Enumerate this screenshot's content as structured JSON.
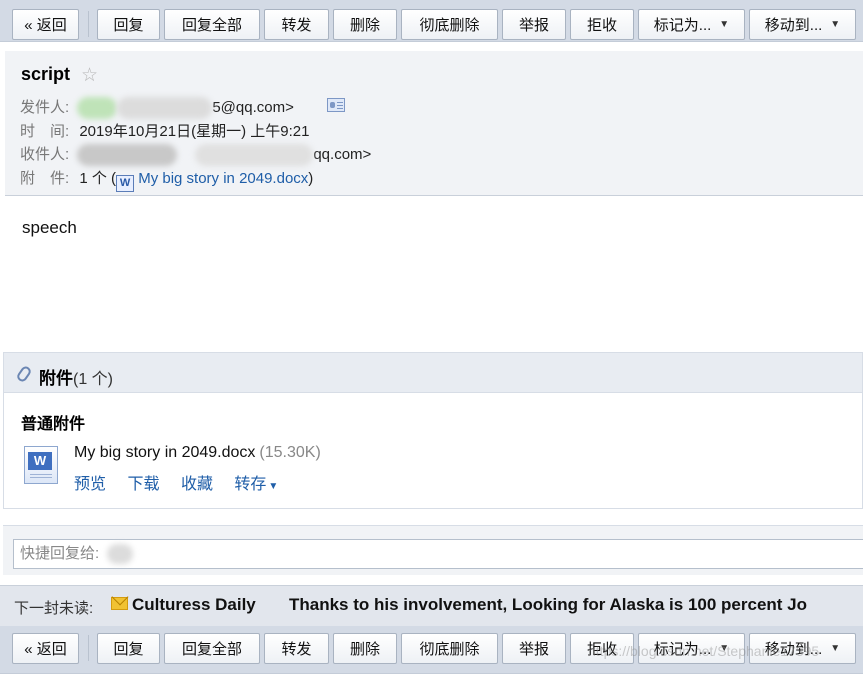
{
  "toolbar": {
    "back": "« 返回",
    "reply": "回复",
    "reply_all": "回复全部",
    "forward": "转发",
    "delete": "删除",
    "delete_perm": "彻底删除",
    "report": "举报",
    "reject": "拒收",
    "mark_as": "标记为...",
    "move_to": "移动到..."
  },
  "email": {
    "subject": "script",
    "from_label": "发件人:",
    "from_value": "5@qq.com>",
    "time_label": "时　间:",
    "time_value": "2019年10月21日(星期一) 上午9:21",
    "to_label": "收件人:",
    "to_value": "qq.com>",
    "attach_label": "附　件:",
    "attach_count": "1 个 (",
    "attach_file": "My big story in 2049.docx",
    "attach_close": ")",
    "body": "speech"
  },
  "attachments": {
    "title": "附件",
    "count": "(1 个)",
    "section_label": "普通附件",
    "file_name": "My big story in 2049.docx",
    "file_size": "(15.30K)",
    "preview": "预览",
    "download": "下载",
    "favorite": "收藏",
    "save_to": "转存"
  },
  "quick_reply": {
    "placeholder": "快捷回复给:"
  },
  "next_unread": {
    "label": "下一封未读:",
    "sender": "Culturess Daily",
    "subject": "Thanks to his involvement, Looking for Alaska is 100 percent Jo"
  },
  "watermark": "https://blog.csdn.net/Stephanie17395",
  "icons": {
    "star": "star-icon",
    "contact": "contact-card-icon",
    "word_doc": "word-doc-icon",
    "paperclip": "paperclip-icon",
    "envelope": "envelope-icon"
  },
  "colors": {
    "toolbar_bg": "#d3dae5",
    "link": "#1f5ea8",
    "header_bg": "#f1f3f6"
  }
}
